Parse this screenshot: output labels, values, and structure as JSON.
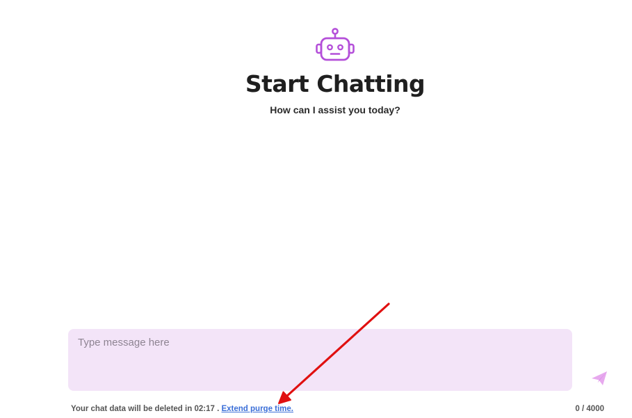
{
  "header": {
    "icon": "robot-icon",
    "title": "Start Chatting",
    "subtitle": "How can I assist you today?"
  },
  "composer": {
    "placeholder": "Type message here",
    "value": "",
    "send_icon": "paper-plane-icon"
  },
  "footer": {
    "purge_prefix": "Your chat data will be deleted in",
    "purge_time": "02:17",
    "purge_separator": ".",
    "extend_link": "Extend purge time.",
    "char_count": "0 / 4000"
  },
  "colors": {
    "accent": "#b44fd9",
    "input_background": "#f3e4f8",
    "link": "#3b6fd8",
    "annotation_arrow": "#e01010"
  }
}
